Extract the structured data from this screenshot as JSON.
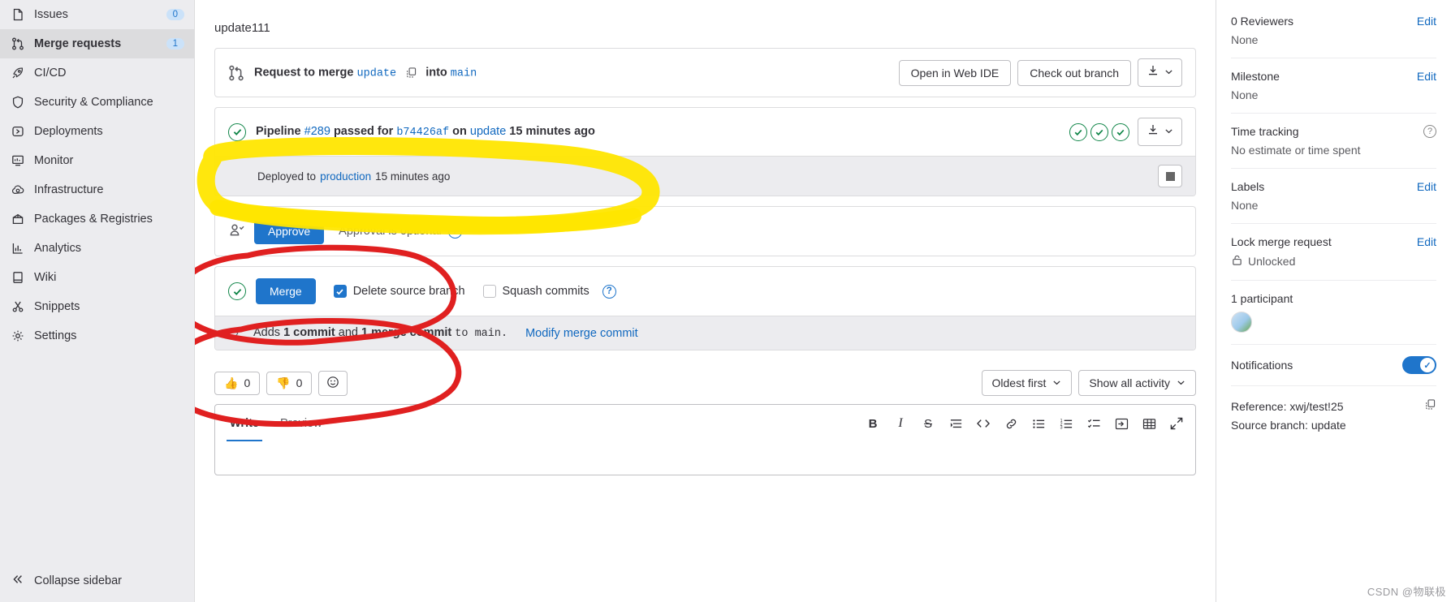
{
  "sidebar": {
    "items": [
      {
        "label": "Issues",
        "icon": "issues-icon",
        "badge": "0",
        "active": false
      },
      {
        "label": "Merge requests",
        "icon": "merge-request-icon",
        "badge": "1",
        "active": true
      },
      {
        "label": "CI/CD",
        "icon": "rocket-icon",
        "badge": "",
        "active": false
      },
      {
        "label": "Security & Compliance",
        "icon": "shield-icon",
        "badge": "",
        "active": false
      },
      {
        "label": "Deployments",
        "icon": "deployments-icon",
        "badge": "",
        "active": false
      },
      {
        "label": "Monitor",
        "icon": "monitor-icon",
        "badge": "",
        "active": false
      },
      {
        "label": "Infrastructure",
        "icon": "cloud-gear-icon",
        "badge": "",
        "active": false
      },
      {
        "label": "Packages & Registries",
        "icon": "package-icon",
        "badge": "",
        "active": false
      },
      {
        "label": "Analytics",
        "icon": "chart-icon",
        "badge": "",
        "active": false
      },
      {
        "label": "Wiki",
        "icon": "book-icon",
        "badge": "",
        "active": false
      },
      {
        "label": "Snippets",
        "icon": "scissors-icon",
        "badge": "",
        "active": false
      },
      {
        "label": "Settings",
        "icon": "gear-icon",
        "badge": "",
        "active": false
      }
    ],
    "collapse_label": "Collapse sidebar"
  },
  "main": {
    "mr_title": "update111",
    "merge_header": {
      "prefix": "Request to merge",
      "source_branch": "update",
      "into": "into",
      "target_branch": "main",
      "open_web_ide": "Open in Web IDE",
      "check_out_branch": "Check out branch"
    },
    "pipeline": {
      "word_pipeline": "Pipeline",
      "id": "#289",
      "passed_for": "passed for",
      "commit_sha": "b74426af",
      "on": "on",
      "branch": "update",
      "time": "15 minutes ago",
      "stage_count": 3
    },
    "deployment": {
      "deployed_to": "Deployed to",
      "environment": "production",
      "time": "15 minutes ago"
    },
    "approval": {
      "approve_label": "Approve",
      "optional_text": "Approval is optional"
    },
    "merge": {
      "merge_label": "Merge",
      "delete_source_branch": "Delete source branch",
      "delete_source_checked": true,
      "squash_commits": "Squash commits",
      "squash_checked": false
    },
    "commits_summary": {
      "adds": "Adds",
      "commit_count": "1 commit",
      "and": "and",
      "merge_commit_count": "1 merge commit",
      "to_branch": "to main.",
      "modify_link": "Modify merge commit"
    },
    "reactions": {
      "thumbs_up_count": "0",
      "thumbs_down_count": "0",
      "sort_label": "Oldest first",
      "activity_label": "Show all activity"
    },
    "editor": {
      "tab_write": "Write",
      "tab_preview": "Preview",
      "tools": [
        "bold-icon",
        "italic-icon",
        "strikethrough-icon",
        "quote-icon",
        "code-icon",
        "link-icon",
        "bulleted-list-icon",
        "numbered-list-icon",
        "task-list-icon",
        "collapsible-icon",
        "table-icon",
        "fullscreen-icon"
      ],
      "tool_labels": [
        "B",
        "I",
        "S"
      ]
    }
  },
  "right_sidebar": {
    "blocks": [
      {
        "title": "0 Reviewers",
        "action": "Edit",
        "value": "None"
      },
      {
        "title": "Milestone",
        "action": "Edit",
        "value": "None"
      },
      {
        "title": "Time tracking",
        "action": "",
        "value": "No estimate or time spent",
        "help": true
      },
      {
        "title": "Labels",
        "action": "Edit",
        "value": "None"
      },
      {
        "title": "Lock merge request",
        "action": "Edit",
        "value": "Unlocked",
        "lock": true
      },
      {
        "title": "1 participant",
        "action": "",
        "value": "",
        "avatar": true
      },
      {
        "title": "Notifications",
        "action": "",
        "value": "",
        "toggle": true
      }
    ],
    "reference_label": "Reference: xwj/test!25",
    "source_branch_label": "Source branch: update"
  },
  "annotations": {
    "highlight_color": "#FFE600",
    "circle_color": "#E02020"
  },
  "watermark": "CSDN @物联极"
}
